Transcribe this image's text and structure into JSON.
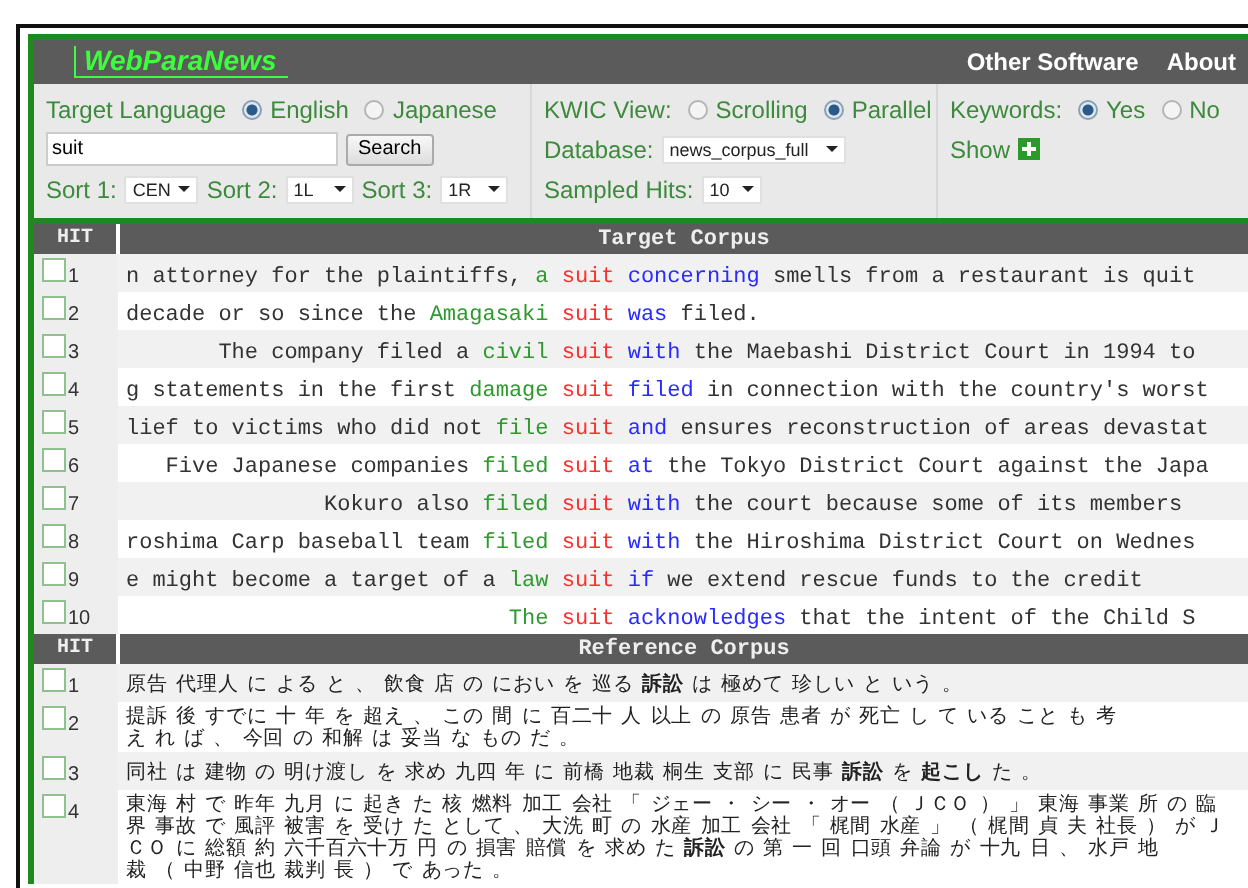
{
  "header": {
    "logo": "WebParaNews",
    "links": [
      "Other Software",
      "About"
    ]
  },
  "controls": {
    "target_language": {
      "label": "Target Language",
      "options": [
        {
          "label": "English",
          "selected": true
        },
        {
          "label": "Japanese",
          "selected": false
        }
      ]
    },
    "search": {
      "value": "suit",
      "button": "Search"
    },
    "sorts": [
      {
        "label": "Sort 1:",
        "value": "CEN"
      },
      {
        "label": "Sort 2:",
        "value": "1L"
      },
      {
        "label": "Sort 3:",
        "value": "1R"
      }
    ],
    "kwic_view": {
      "label": "KWIC View:",
      "options": [
        {
          "label": "Scrolling",
          "selected": false
        },
        {
          "label": "Parallel",
          "selected": true
        }
      ]
    },
    "database": {
      "label": "Database:",
      "value": "news_corpus_full"
    },
    "sampled_hits": {
      "label": "Sampled Hits:",
      "value": "10"
    },
    "keywords": {
      "label": "Keywords:",
      "options": [
        {
          "label": "Yes",
          "selected": true
        },
        {
          "label": "No",
          "selected": false
        }
      ]
    },
    "show": {
      "label": "Show"
    }
  },
  "target": {
    "columns": [
      "HIT",
      "Target Corpus"
    ],
    "rows": [
      {
        "hit": "1",
        "checked": false,
        "left": "n attorney for the plaintiffs,",
        "collocate": "a",
        "keyword": "suit",
        "next": "concerning",
        "rest": "smells from a restaurant is quit"
      },
      {
        "hit": "2",
        "checked": false,
        "left": "decade or so since the",
        "collocate": "Amagasaki",
        "keyword": "suit",
        "next": "was",
        "rest": "filed."
      },
      {
        "hit": "3",
        "checked": false,
        "left": "The company filed a",
        "collocate": "civil",
        "keyword": "suit",
        "next": "with",
        "rest": "the Maebashi District Court in 1994 to"
      },
      {
        "hit": "4",
        "checked": false,
        "left": "g statements in the first",
        "collocate": "damage",
        "keyword": "suit",
        "next": "filed",
        "rest": "in connection with the country's worst"
      },
      {
        "hit": "5",
        "checked": false,
        "left": "lief to victims who did not",
        "collocate": "file",
        "keyword": "suit",
        "next": "and",
        "rest": "ensures reconstruction of areas devastat"
      },
      {
        "hit": "6",
        "checked": false,
        "left": "Five Japanese companies",
        "collocate": "filed",
        "keyword": "suit",
        "next": "at",
        "rest": "the Tokyo District Court against the Japa"
      },
      {
        "hit": "7",
        "checked": false,
        "left": "Kokuro also",
        "collocate": "filed",
        "keyword": "suit",
        "next": "with",
        "rest": "the court because some of its members"
      },
      {
        "hit": "8",
        "checked": false,
        "left": "roshima Carp baseball team",
        "collocate": "filed",
        "keyword": "suit",
        "next": "with",
        "rest": "the Hiroshima District Court on Wednes"
      },
      {
        "hit": "9",
        "checked": false,
        "left": "e might become a target of a",
        "collocate": "law",
        "keyword": "suit",
        "next": "if",
        "rest": "we extend rescue funds to the credit"
      },
      {
        "hit": "10",
        "checked": false,
        "collocate": "The",
        "keyword": "suit",
        "next": "acknowledges",
        "rest": "that the intent of the Child S"
      }
    ]
  },
  "reference": {
    "columns": [
      "HIT",
      "Reference Corpus"
    ],
    "rows": [
      {
        "hit": "1",
        "checked": false,
        "text": "原告 代理人 に よる と 、 飲食 店 の におい を 巡る **訴訟** は 極めて 珍しい と いう 。"
      },
      {
        "hit": "2",
        "checked": false,
        "text": "提訴 後 すでに 十 年 を 超え 、 この 間 に 百二十 人 以上 の 原告 患者 が 死亡 し て いる こと も 考え れ ば 、 今回 の 和解 は 妥当 な もの だ 。"
      },
      {
        "hit": "3",
        "checked": false,
        "text": "同社 は 建物 の 明け渡し を 求め 九四 年 に 前橋 地裁 桐生 支部 に 民事 **訴訟** を **起こし** た 。"
      },
      {
        "hit": "4",
        "checked": false,
        "text": "東海 村 で 昨年 九月 に 起き た 核 燃料 加工 会社 「 ジェー ・ シー ・ オー （ ＪＣＯ ） 」 東海 事業 所 の 臨界 事故 で 風評 被害 を 受け た として 、 大洗 町 の 水産 加工 会社 「 梶間 水産 」 （ 梶間 貞 夫 社長 ） が ＪＣＯ に 総額 約 六千百六十万 円 の 損害 賠償 を 求め た **訴訟** の 第 一 回 口頭 弁論 が 十九 日 、 水戸 地裁 （ 中野 信也 裁判 長 ） で あった 。"
      }
    ]
  }
}
